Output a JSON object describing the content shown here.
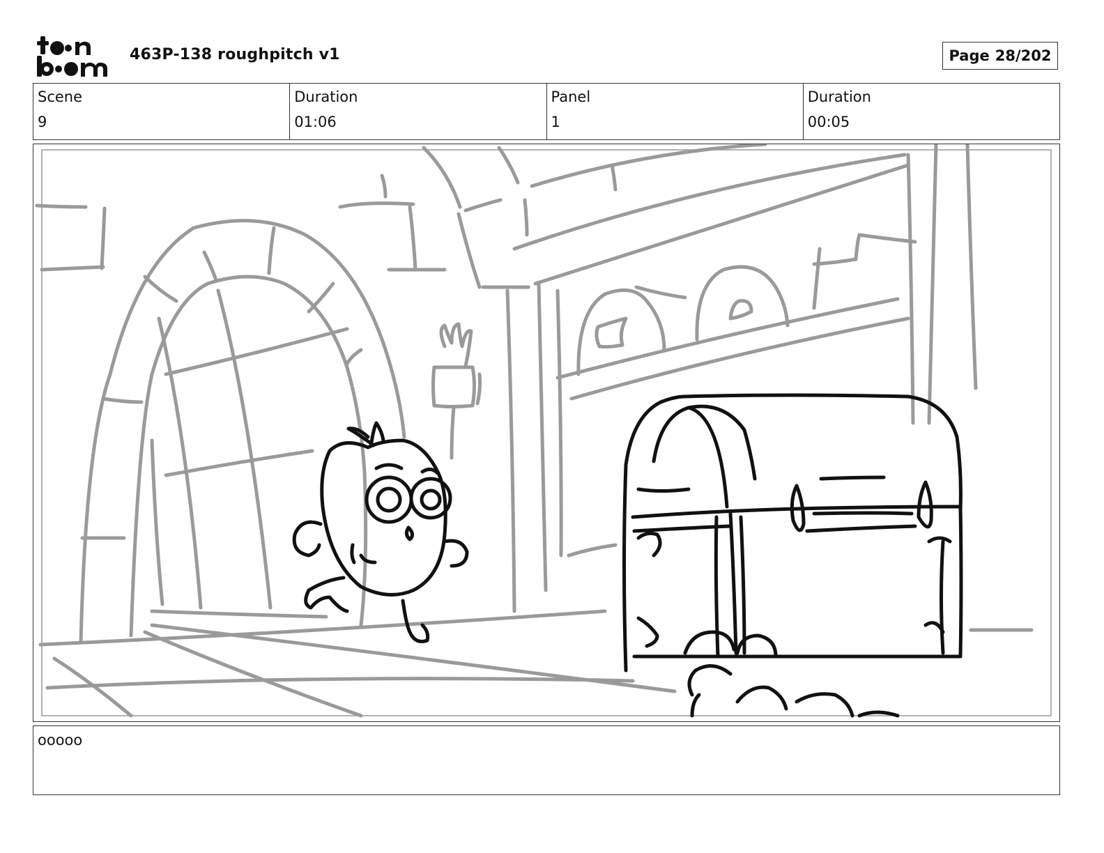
{
  "logo": {
    "line1": "toon",
    "line2": "boom"
  },
  "header": {
    "title": "463P-138 roughpitch v1",
    "page_label": "Page",
    "page_value": "28/202"
  },
  "info": [
    {
      "label": "Scene",
      "value": "9"
    },
    {
      "label": "Duration",
      "value": "01:06"
    },
    {
      "label": "Panel",
      "value": "1"
    },
    {
      "label": "Duration",
      "value": "00:05"
    }
  ],
  "notes": {
    "text": "ooooo"
  },
  "colors": {
    "sketch_gray": "#9a9a9a",
    "ink": "#111111",
    "border": "#333333"
  }
}
